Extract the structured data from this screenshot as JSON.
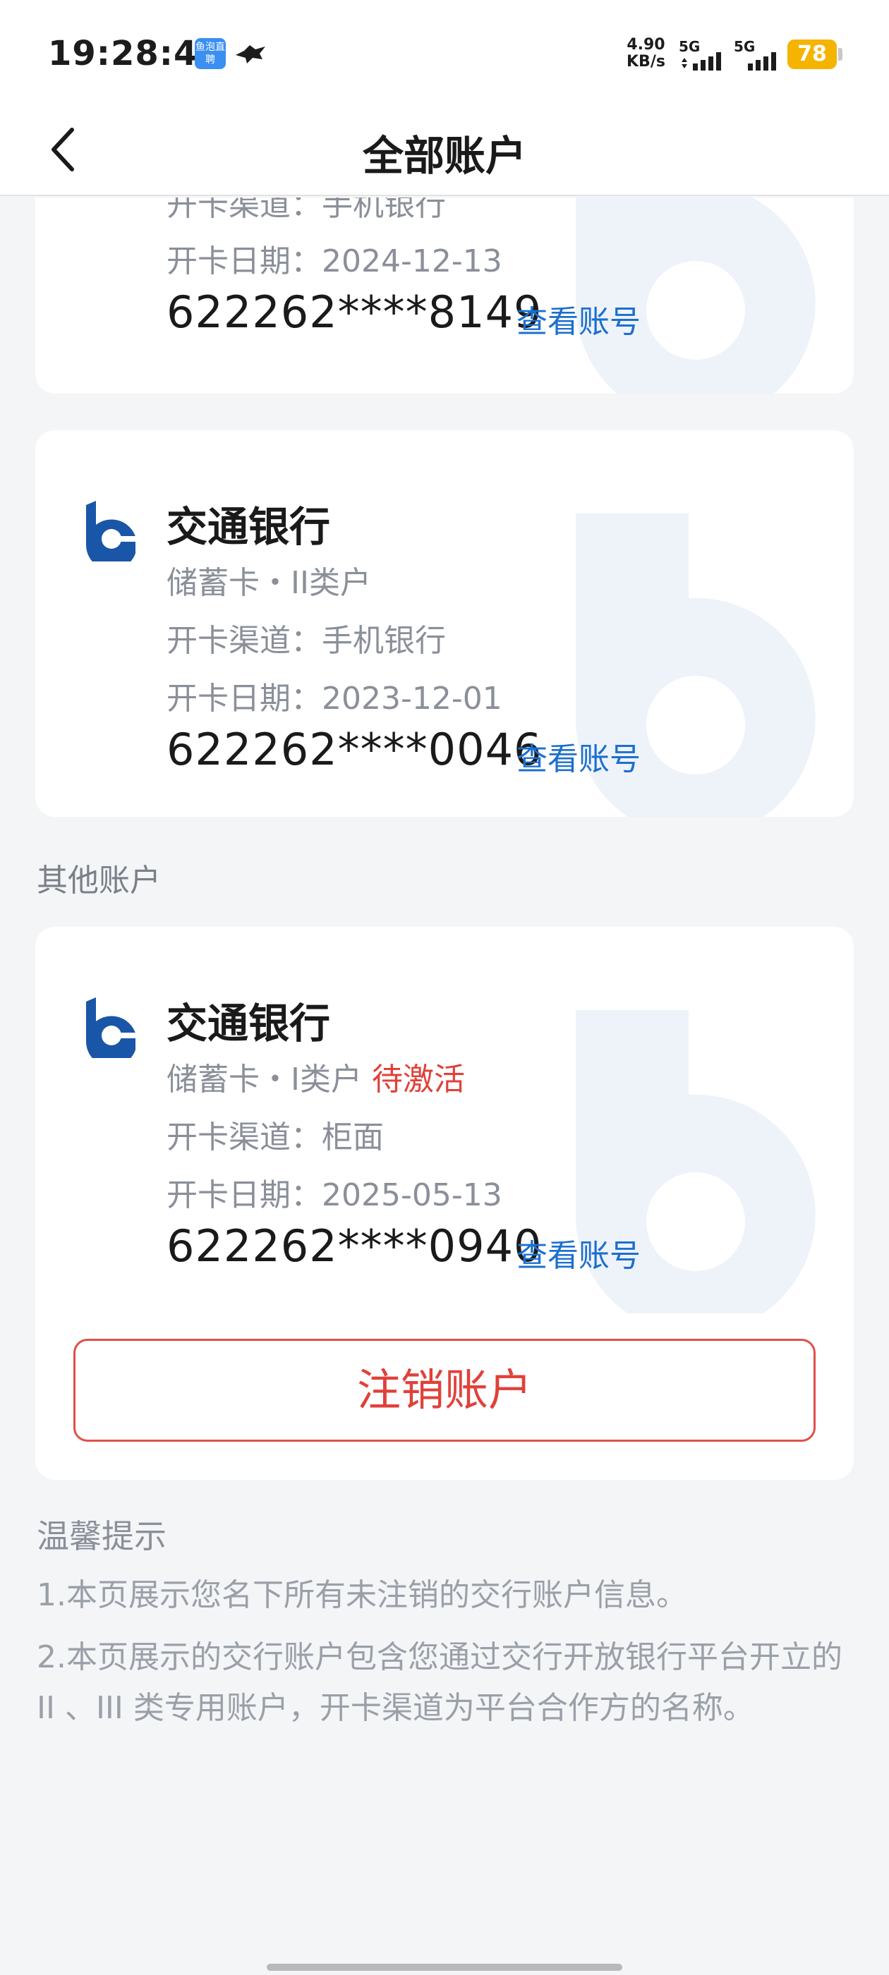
{
  "status_bar": {
    "time": "19:28:42",
    "app_badge": "鱼泡直聘",
    "net_speed_value": "4.90",
    "net_speed_unit": "KB/s",
    "signal1_label": "5G",
    "signal2_label": "5G",
    "battery": "78",
    "battery_color": "#f4b400"
  },
  "nav": {
    "title": "全部账户",
    "back_icon": "chevron-left-icon"
  },
  "cards": [
    {
      "channel": "开卡渠道：手机银行",
      "date": "开卡日期：2024-12-13",
      "account": "622262****8149",
      "view_link": "查看账号"
    },
    {
      "bank": "交通银行",
      "type": "储蓄卡・II类户",
      "channel": "开卡渠道：手机银行",
      "date": "开卡日期：2023-12-01",
      "account": "622262****0046",
      "view_link": "查看账号"
    }
  ],
  "other_section": {
    "label": "其他账户",
    "card": {
      "bank": "交通银行",
      "type": "储蓄卡・I类户",
      "status": "待激活",
      "channel": "开卡渠道：柜面",
      "date": "开卡日期：2025-05-13",
      "account": "622262****0940",
      "view_link": "查看账号",
      "cancel_button": "注销账户"
    }
  },
  "tips": {
    "title": "温馨提示",
    "items": [
      "1.本页展示您名下所有未注销的交行账户信息。",
      "2.本页展示的交行账户包含您通过交行开放银行平台开立的 II 、III 类专用账户，开卡渠道为平台合作方的名称。"
    ]
  },
  "colors": {
    "accent_link": "#1c6fcf",
    "warning_red": "#e0413a",
    "bank_blue": "#1a56a8"
  }
}
